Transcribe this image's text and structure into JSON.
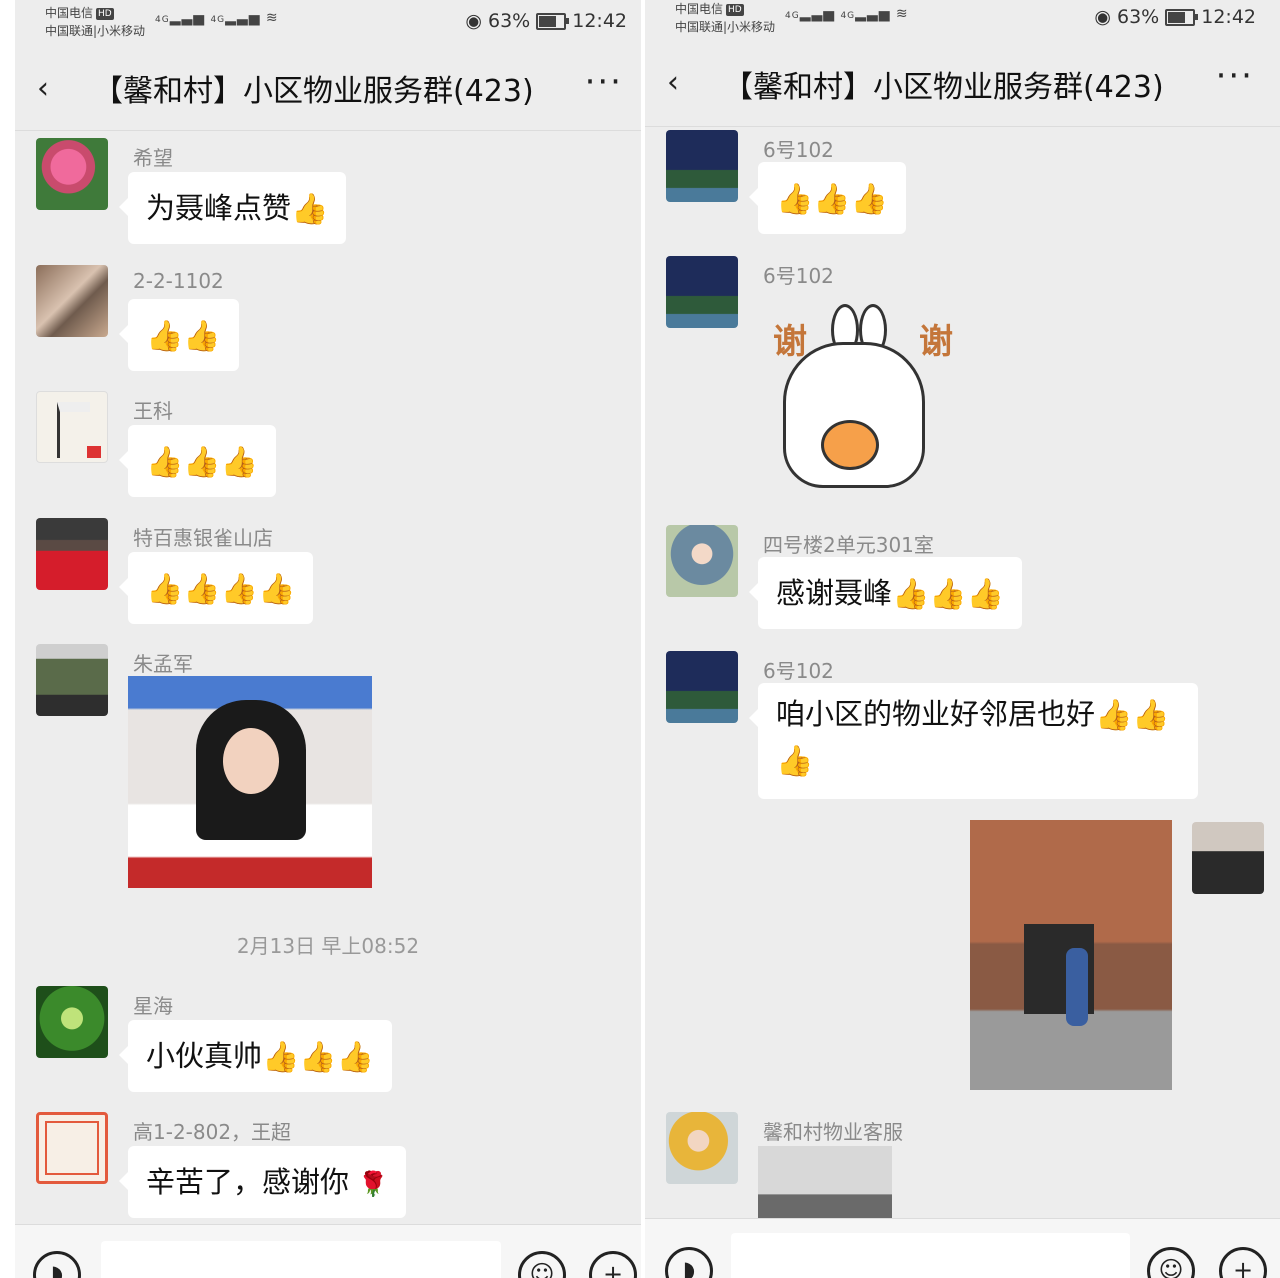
{
  "status": {
    "carrier_top": "中国电信",
    "hd_badge": "HD",
    "carrier_bottom": "中国联通|小米移动",
    "signal_1": "4G",
    "signal_2": "4G",
    "battery_percent": "63%",
    "battery_level": 0.63,
    "time": "12:42"
  },
  "header": {
    "title": "【馨和村】小区物业服务群(423)",
    "back_icon": "chevron-left-icon",
    "more_icon": "more-dots-icon"
  },
  "left_messages": [
    {
      "sender": "希望",
      "text": "为聂峰点赞",
      "thumbs": 1
    },
    {
      "sender": "2-2-1102",
      "text": "",
      "thumbs": 2
    },
    {
      "sender": "王科",
      "text": "",
      "thumbs": 3
    },
    {
      "sender": "特百惠银雀山店",
      "text": "",
      "thumbs": 4
    },
    {
      "sender": "朱孟军",
      "image": "celebrity-thumbs-up-photo"
    },
    {
      "timestamp": "2月13日 早上08:52"
    },
    {
      "sender": "星海",
      "text": "小伙真帅",
      "thumbs": 3
    },
    {
      "sender": "高1-2-802，王超",
      "text": "辛苦了，感谢你",
      "emoji": "rose-icon"
    }
  ],
  "right_messages": [
    {
      "sender": "6号102",
      "text": "",
      "thumbs": 3
    },
    {
      "sender": "6号102",
      "sticker": "rabbit-thanks-sticker",
      "sticker_text_left": "谢",
      "sticker_text_right": "谢"
    },
    {
      "sender": "四号楼2单元301室",
      "text": "感谢聂峰",
      "thumbs": 3
    },
    {
      "sender": "6号102",
      "text_line1": "咱小区的物业好邻居也好",
      "thumbs_line1": 2,
      "thumbs_line2": 1
    },
    {
      "sender": "",
      "self": true,
      "image": "building-entrance-photo"
    },
    {
      "sender": "馨和村物业客服",
      "image": "outdoor-photo"
    }
  ],
  "input_bar": {
    "voice_icon": "voice-icon",
    "emoji_icon": "emoji-icon",
    "plus_icon": "plus-icon"
  }
}
